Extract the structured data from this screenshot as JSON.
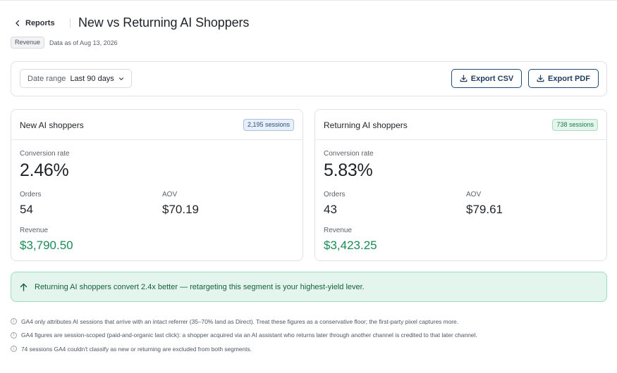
{
  "header": {
    "back_label": "Reports",
    "title": "New vs Returning AI Shoppers",
    "tag": "Revenue",
    "as_of": "Data as of Aug 13, 2026"
  },
  "toolbar": {
    "date_range_label": "Date range",
    "date_range_value": "Last 90 days",
    "export_csv": "Export CSV",
    "export_pdf": "Export PDF"
  },
  "cards": {
    "new": {
      "title": "New AI shoppers",
      "sessions_badge": "2,195 sessions",
      "conversion_label": "Conversion rate",
      "conversion_value": "2.46%",
      "orders_label": "Orders",
      "orders_value": "54",
      "aov_label": "AOV",
      "aov_value": "$70.19",
      "revenue_label": "Revenue",
      "revenue_value": "$3,790.50"
    },
    "returning": {
      "title": "Returning AI shoppers",
      "sessions_badge": "738 sessions",
      "conversion_label": "Conversion rate",
      "conversion_value": "5.83%",
      "orders_label": "Orders",
      "orders_value": "43",
      "aov_label": "AOV",
      "aov_value": "$79.61",
      "revenue_label": "Revenue",
      "revenue_value": "$3,423.25"
    }
  },
  "callout": {
    "icon": "arrow-up-icon",
    "text": "Returning AI shoppers convert 2.4x better — retargeting this segment is your highest-yield lever."
  },
  "notes": [
    "GA4 only attributes AI sessions that arrive with an intact referrer (35–70% land as Direct). Treat these figures as a conservative floor; the first-party pixel captures more.",
    "GA4 figures are session-scoped (paid-and-organic last click): a shopper acquired via an AI assistant who returns later through another channel is credited to that later channel.",
    "74 sessions GA4 couldn't classify as new or returning are excluded from both segments."
  ],
  "colors": {
    "accent_navy": "#1e4a77",
    "positive_green": "#1b8a55",
    "callout_bg": "#e3f5ec"
  }
}
